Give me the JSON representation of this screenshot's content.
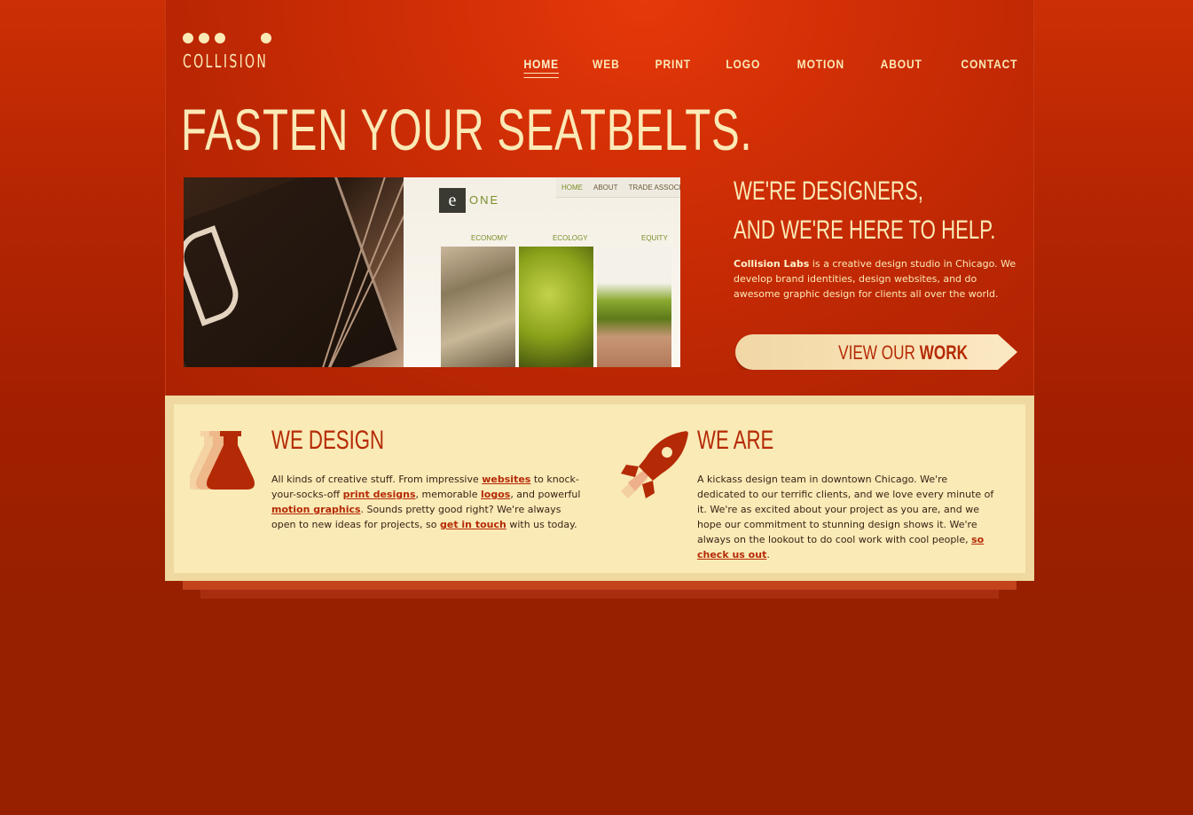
{
  "brand": {
    "name": "COLLISION"
  },
  "nav": {
    "items": [
      {
        "label": "HOME",
        "active": true
      },
      {
        "label": "WEB"
      },
      {
        "label": "PRINT"
      },
      {
        "label": "LOGO"
      },
      {
        "label": "MOTION"
      },
      {
        "label": "ABOUT"
      },
      {
        "label": "CONTACT"
      }
    ]
  },
  "hero": {
    "headline": "FASTEN YOUR SEATBELTS.",
    "tagline_line1": "WE'RE DESIGNERS,",
    "tagline_line2": "AND WE'RE HERE TO HELP.",
    "intro_strong": "Collision Labs",
    "intro_rest": " is a creative design studio in Chicago. We develop brand identities, design websites, and do awesome graphic design for clients all over the world.",
    "cta_prefix": "VIEW OUR ",
    "cta_strong": "WORK"
  },
  "screenshot_preview": {
    "nav": [
      "HOME",
      "ABOUT",
      "TRADE ASSOCIATI"
    ],
    "logo_letter": "e",
    "logo_word": "ONE",
    "columns": [
      "ECONOMY",
      "ECOLOGY",
      "EQUITY"
    ]
  },
  "features": {
    "design": {
      "title": "WE DESIGN",
      "t1": "All kinds of creative stuff. From impressive ",
      "l1": "websites",
      "t2": " to knock-your-socks-off ",
      "l2": "print designs",
      "t3": ", memorable ",
      "l3": "logos",
      "t4": ", and powerful ",
      "l4": "motion graphics",
      "t5": ". Sounds pretty good right? We're always open to new ideas for projects, so ",
      "l5": "get in touch",
      "t6": " with us today."
    },
    "are": {
      "title": "WE ARE",
      "t1": "A kickass design team in downtown Chicago. We're dedicated to our terrific clients, and we love every minute of it. We're as excited about your project as you are, and we hope our commitment to stunning design shows it. We're always on the lookout to do cool work with cool people, ",
      "l1": "so check us out",
      "t2": "."
    }
  },
  "colors": {
    "background": "#962000",
    "hero": "#d22f06",
    "cream": "#fbe9b6",
    "panel": "#f9eab6",
    "accent": "#b52a06"
  },
  "icons": {
    "flask": "flask-icon",
    "rocket": "rocket-icon"
  }
}
